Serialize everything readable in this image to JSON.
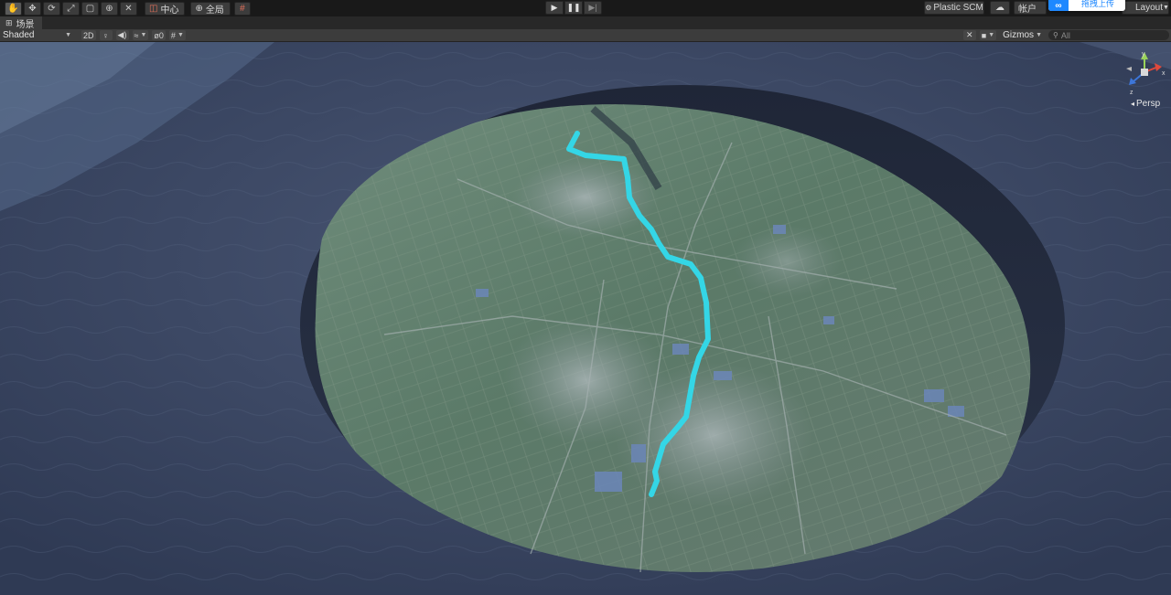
{
  "toolbar": {
    "tools": [
      {
        "name": "hand-tool",
        "glyph": "✋"
      },
      {
        "name": "move-tool",
        "glyph": "✥"
      },
      {
        "name": "rotate-tool",
        "glyph": "⟳"
      },
      {
        "name": "scale-tool",
        "glyph": "⤢"
      },
      {
        "name": "rect-tool",
        "glyph": "▢"
      },
      {
        "name": "transform-tool",
        "glyph": "⊕"
      },
      {
        "name": "custom-tool",
        "glyph": "✕"
      }
    ],
    "pivot_label": "中心",
    "global_label": "全局",
    "plastic_label": "Plastic SCM",
    "account_label": "帐户",
    "upload_label": "拖拽上传",
    "layout_label": "Layout"
  },
  "scene_tab": {
    "label": "场景"
  },
  "scene_toolbar": {
    "shading_mode": "Shaded",
    "mode_2d": "2D",
    "hidden_count": "0",
    "gizmos_label": "Gizmos",
    "search_placeholder": "All"
  },
  "viewport": {
    "camera_mode": "Persp",
    "axis_labels": {
      "y": "y",
      "z": "z",
      "x": "x"
    },
    "colors": {
      "water": "#3f4b66",
      "terrain_green": "#5f7f6c",
      "river_path": "#34d6e6"
    }
  },
  "icons": {
    "play": "play-icon",
    "pause": "pause-icon",
    "step": "step-icon",
    "scene": "scene-icon",
    "lighting": "light-bulb-icon",
    "audio": "speaker-icon",
    "effects": "effects-icon",
    "visibility": "eye-off-icon",
    "grid": "grid-icon",
    "tools": "tools-icon",
    "camera": "camera-icon",
    "search": "search-icon"
  }
}
